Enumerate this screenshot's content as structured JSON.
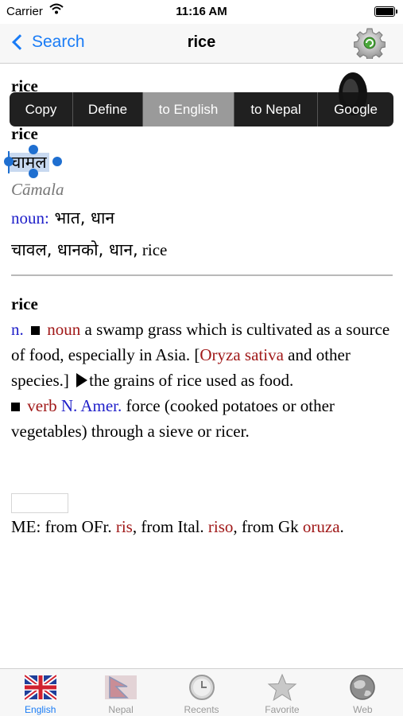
{
  "status_bar": {
    "carrier": "Carrier",
    "time": "11:16 AM",
    "wifi_icon": "wifi-icon",
    "battery_level": 1.0
  },
  "navbar": {
    "back_label": "Search",
    "title": "rice",
    "settings_icon": "gear-refresh-icon"
  },
  "content": {
    "headword_1": "rice",
    "headword_2": "rice",
    "devanagari": "चामल",
    "transliteration": "Cāmala",
    "pos_label": "noun:",
    "pos_translations": " भात, धान",
    "synonyms_dev": "चावल, धानको, धान,",
    "synonyms_en": " rice",
    "entry": {
      "headword": "rice",
      "abbr_n": "n.",
      "pos_noun": "noun",
      "def1": " a swamp grass which is cultivated as a source of food, especially in Asia. [",
      "latin": "Oryza sativa",
      "def1_tail": " and other species.]",
      "def2": "the grains of rice used as food.",
      "pos_verb": "verb",
      "region": "N. Amer.",
      "def3": " force (cooked potatoes or other vegetables) through a sieve or ricer."
    },
    "etymology": {
      "prefix": "ME: from OFr. ",
      "w1": "ris",
      "mid1": ", from Ital. ",
      "w2": "riso",
      "mid2": ", from Gk ",
      "w3": "oruza",
      "end": "."
    }
  },
  "edit_menu": {
    "items": [
      "Copy",
      "Define",
      "to English",
      "to Nepal",
      "Google"
    ],
    "active_index": 2
  },
  "tabbar": {
    "items": [
      {
        "label": "English",
        "icon": "uk-flag-icon",
        "active": true
      },
      {
        "label": "Nepal",
        "icon": "nepal-flag-icon",
        "active": false
      },
      {
        "label": "Recents",
        "icon": "clock-icon",
        "active": false
      },
      {
        "label": "Favorite",
        "icon": "star-icon",
        "active": false
      },
      {
        "label": "Web",
        "icon": "globe-icon",
        "active": false
      }
    ]
  },
  "colors": {
    "accent": "#1a7cf6",
    "pos_blue": "#1e1ec9",
    "etym_red": "#a01818",
    "selection": "#c8d9f0"
  }
}
